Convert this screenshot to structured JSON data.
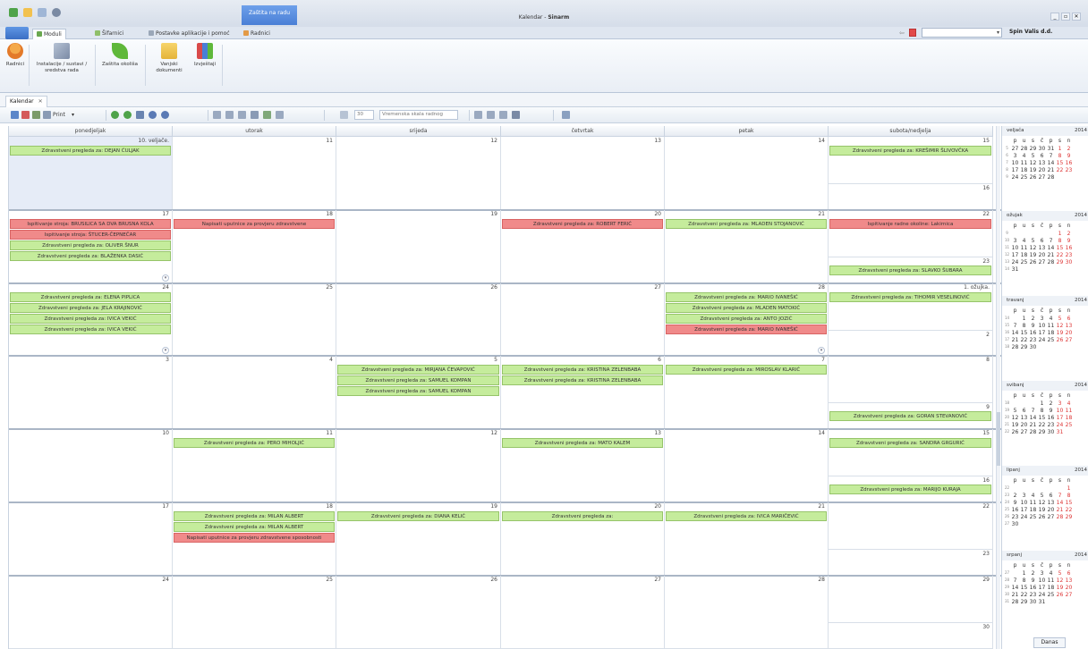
{
  "titlebar": {
    "context_tab": "Zaštita na radu",
    "app_name": "Kalendar",
    "separator": " - ",
    "app_brand": "Sinarm",
    "controls": [
      "_",
      "▫",
      "✕"
    ]
  },
  "ribbon_tabs": [
    "Moduli",
    "Šifarnici",
    "Postavke aplikacije i pomoć",
    "Radnici"
  ],
  "company": "Spin Valis d.d.",
  "search": {
    "value": "",
    "dropdown": "▾"
  },
  "ribbon_buttons": [
    {
      "label": "Radnici"
    },
    {
      "label": "Instalacije / sustavi / sredstva rada"
    },
    {
      "label": "Zaštita okoliša"
    },
    {
      "label": "Vanjski dokumenti"
    },
    {
      "label": "Izvještaji"
    }
  ],
  "doc_tab": {
    "label": "Kalendar",
    "close": "✕"
  },
  "toolbar": {
    "print_label": "Print",
    "hours_value": "30",
    "workday_label": "Vremenska skala radnog",
    "dd": "▾"
  },
  "day_headers": [
    "ponedjeljak",
    "utorak",
    "srijeda",
    "četvrtak",
    "petak",
    "subota/nedjelja"
  ],
  "weeks": [
    {
      "days": [
        {
          "num": "10. veljače.",
          "events": [
            {
              "text": "Zdravstveni pregleda za: DEJAN ĆULJAK",
              "type": "green"
            }
          ]
        },
        {
          "num": "11",
          "events": []
        },
        {
          "num": "12",
          "events": []
        },
        {
          "num": "13",
          "events": []
        },
        {
          "num": "14",
          "events": []
        },
        {
          "num": "15",
          "events": [
            {
              "text": "Zdravstveni pregleda za: KREŠIMIR ŠLIVOVČKA",
              "type": "green"
            }
          ]
        }
      ],
      "sunday": {
        "num": "16",
        "events": []
      }
    },
    {
      "days": [
        {
          "num": "17",
          "events": [
            {
              "text": "Ispitivanje stroja: BRUSILICA SA DVA BRUSNA KOLA",
              "type": "red"
            },
            {
              "text": "Ispitivanje stroja: ŠTUCER-ČEPNEČAR",
              "type": "red"
            },
            {
              "text": "Zdravstveni pregleda za: OLIVER ŠNUR",
              "type": "green"
            },
            {
              "text": "Zdravstveni pregleda za: BLAŽENKA DASIĆ",
              "type": "green"
            }
          ]
        },
        {
          "num": "18",
          "events": [
            {
              "text": "Napisati uputnice za provjeru zdravstvene",
              "type": "red"
            }
          ]
        },
        {
          "num": "19",
          "events": []
        },
        {
          "num": "20",
          "events": [
            {
              "text": "Zdravstveni pregleda za: ROBERT FERIĆ",
              "type": "red"
            }
          ]
        },
        {
          "num": "21",
          "events": [
            {
              "text": "Zdravstveni pregleda za: MLADEN STOJANOVIĆ",
              "type": "green"
            }
          ]
        },
        {
          "num": "22",
          "events": [
            {
              "text": "Ispitivanje radne okoline: Lakirnica",
              "type": "red"
            }
          ]
        }
      ],
      "sunday": {
        "num": "23",
        "events": [
          {
            "text": "Zdravstveni pregleda za: SLAVKO ŠUBARA",
            "type": "green"
          }
        ]
      }
    },
    {
      "days": [
        {
          "num": "24",
          "events": [
            {
              "text": "Zdravstveni pregleda za: ELENA PIPLICA",
              "type": "green"
            },
            {
              "text": "Zdravstveni pregleda za: JELA KRAJINOVIĆ",
              "type": "green"
            },
            {
              "text": "Zdravstveni pregleda za: IVICA VEKIĆ",
              "type": "green"
            },
            {
              "text": "Zdravstveni pregleda za: IVICA VEKIĆ",
              "type": "green"
            }
          ]
        },
        {
          "num": "25",
          "events": []
        },
        {
          "num": "26",
          "events": []
        },
        {
          "num": "27",
          "events": []
        },
        {
          "num": "28",
          "events": [
            {
              "text": "Zdravstveni pregleda za: MARIO IVANEŠIĆ",
              "type": "green"
            },
            {
              "text": "Zdravstveni pregleda za: MLADEN MATOKIĆ",
              "type": "green"
            },
            {
              "text": "Zdravstveni pregleda za: ANTO JOZIĆ",
              "type": "green"
            },
            {
              "text": "Zdravstveni pregleda za: MARIO IVANEŠIĆ",
              "type": "red"
            }
          ]
        },
        {
          "num": "1. ožujka.",
          "events": [
            {
              "text": "Zdravstveni pregleda za: TIHOMIR VESELINOVIĆ",
              "type": "green"
            }
          ]
        }
      ],
      "sunday": {
        "num": "2",
        "events": []
      }
    },
    {
      "days": [
        {
          "num": "3",
          "events": []
        },
        {
          "num": "4",
          "events": []
        },
        {
          "num": "5",
          "events": [
            {
              "text": "Zdravstveni pregleda za: MIRJANA ČEVAPOVIĆ",
              "type": "green"
            },
            {
              "text": "Zdravstveni pregleda za: SAMUEL KOMPAN",
              "type": "green"
            },
            {
              "text": "Zdravstveni pregleda za: SAMUEL KOMPAN",
              "type": "green"
            }
          ]
        },
        {
          "num": "6",
          "events": [
            {
              "text": "Zdravstveni pregleda za: KRISTINA ZELENBABA",
              "type": "green"
            },
            {
              "text": "Zdravstveni pregleda za: KRISTINA ZELENBABA",
              "type": "green"
            }
          ]
        },
        {
          "num": "7",
          "events": [
            {
              "text": "Zdravstveni pregleda za: MIROSLAV KLARIĆ",
              "type": "green"
            }
          ]
        },
        {
          "num": "8",
          "events": []
        }
      ],
      "sunday": {
        "num": "9",
        "events": [
          {
            "text": "Zdravstveni pregleda za: GORAN STEVANOVIĆ",
            "type": "green"
          }
        ]
      }
    },
    {
      "days": [
        {
          "num": "10",
          "events": []
        },
        {
          "num": "11",
          "events": [
            {
              "text": "Zdravstveni pregleda za: PERO MIHOLJIĆ",
              "type": "green"
            }
          ]
        },
        {
          "num": "12",
          "events": []
        },
        {
          "num": "13",
          "events": [
            {
              "text": "Zdravstveni pregleda za: MATO KALEM",
              "type": "green"
            }
          ]
        },
        {
          "num": "14",
          "events": []
        },
        {
          "num": "15",
          "events": [
            {
              "text": "Zdravstveni pregleda za: SANDRA GRGURIĆ",
              "type": "green"
            }
          ]
        }
      ],
      "sunday": {
        "num": "16",
        "events": [
          {
            "text": "Zdravstveni pregleda za: MARIJO KURAJA",
            "type": "green"
          }
        ]
      }
    },
    {
      "days": [
        {
          "num": "17",
          "events": []
        },
        {
          "num": "18",
          "events": [
            {
              "text": "Zdravstveni pregleda za: MILAN ALBERT",
              "type": "green"
            },
            {
              "text": "Zdravstveni pregleda za: MILAN ALBERT",
              "type": "green"
            },
            {
              "text": "Napisati uputnice za provjeru zdravstvene sposobnosti",
              "type": "red"
            }
          ]
        },
        {
          "num": "19",
          "events": [
            {
              "text": "Zdravstveni pregleda za: DIANA KELIĆ",
              "type": "green"
            }
          ]
        },
        {
          "num": "20",
          "events": [
            {
              "text": "Zdravstveni pregleda za:",
              "type": "green"
            }
          ]
        },
        {
          "num": "21",
          "events": [
            {
              "text": "Zdravstveni pregleda za: IVICA MARIČEVIĆ",
              "type": "green"
            }
          ]
        },
        {
          "num": "22",
          "events": []
        }
      ],
      "sunday": {
        "num": "23",
        "events": []
      }
    },
    {
      "days": [
        {
          "num": "24",
          "events": []
        },
        {
          "num": "25",
          "events": []
        },
        {
          "num": "26",
          "events": []
        },
        {
          "num": "27",
          "events": []
        },
        {
          "num": "28",
          "events": []
        },
        {
          "num": "29",
          "events": []
        }
      ],
      "sunday": {
        "num": "30",
        "events": []
      }
    }
  ],
  "date_navigator": {
    "dow": [
      "p",
      "u",
      "s",
      "č",
      "p",
      "s",
      "n"
    ],
    "months": [
      {
        "name": "veljača",
        "year": "2014",
        "rows": [
          {
            "wk": "5",
            "days": [
              "27",
              "28",
              "29",
              "30",
              "31",
              "1",
              "2"
            ]
          },
          {
            "wk": "6",
            "days": [
              "3",
              "4",
              "5",
              "6",
              "7",
              "8",
              "9"
            ]
          },
          {
            "wk": "7",
            "days": [
              "10",
              "11",
              "12",
              "13",
              "14",
              "15",
              "16"
            ]
          },
          {
            "wk": "8",
            "days": [
              "17",
              "18",
              "19",
              "20",
              "21",
              "22",
              "23"
            ]
          },
          {
            "wk": "9",
            "days": [
              "24",
              "25",
              "26",
              "27",
              "28",
              "",
              ""
            ]
          }
        ]
      },
      {
        "name": "ožujak",
        "year": "2014",
        "rows": [
          {
            "wk": "9",
            "days": [
              "",
              "",
              "",
              "",
              "",
              "1",
              "2"
            ]
          },
          {
            "wk": "10",
            "days": [
              "3",
              "4",
              "5",
              "6",
              "7",
              "8",
              "9"
            ]
          },
          {
            "wk": "11",
            "days": [
              "10",
              "11",
              "12",
              "13",
              "14",
              "15",
              "16"
            ]
          },
          {
            "wk": "12",
            "days": [
              "17",
              "18",
              "19",
              "20",
              "21",
              "22",
              "23"
            ]
          },
          {
            "wk": "13",
            "days": [
              "24",
              "25",
              "26",
              "27",
              "28",
              "29",
              "30"
            ]
          },
          {
            "wk": "14",
            "days": [
              "31",
              "",
              "",
              "",
              "",
              "",
              ""
            ]
          }
        ]
      },
      {
        "name": "travanj",
        "year": "2014",
        "rows": [
          {
            "wk": "14",
            "days": [
              "",
              "1",
              "2",
              "3",
              "4",
              "5",
              "6"
            ]
          },
          {
            "wk": "15",
            "days": [
              "7",
              "8",
              "9",
              "10",
              "11",
              "12",
              "13"
            ]
          },
          {
            "wk": "16",
            "days": [
              "14",
              "15",
              "16",
              "17",
              "18",
              "19",
              "20"
            ]
          },
          {
            "wk": "17",
            "days": [
              "21",
              "22",
              "23",
              "24",
              "25",
              "26",
              "27"
            ]
          },
          {
            "wk": "18",
            "days": [
              "28",
              "29",
              "30",
              "",
              "",
              "",
              ""
            ]
          }
        ]
      },
      {
        "name": "svibanj",
        "year": "2014",
        "rows": [
          {
            "wk": "18",
            "days": [
              "",
              "",
              "",
              "1",
              "2",
              "3",
              "4"
            ]
          },
          {
            "wk": "19",
            "days": [
              "5",
              "6",
              "7",
              "8",
              "9",
              "10",
              "11"
            ]
          },
          {
            "wk": "20",
            "days": [
              "12",
              "13",
              "14",
              "15",
              "16",
              "17",
              "18"
            ]
          },
          {
            "wk": "21",
            "days": [
              "19",
              "20",
              "21",
              "22",
              "23",
              "24",
              "25"
            ]
          },
          {
            "wk": "22",
            "days": [
              "26",
              "27",
              "28",
              "29",
              "30",
              "31",
              ""
            ]
          }
        ]
      },
      {
        "name": "lipanj",
        "year": "2014",
        "rows": [
          {
            "wk": "22",
            "days": [
              "",
              "",
              "",
              "",
              "",
              "",
              "1"
            ]
          },
          {
            "wk": "23",
            "days": [
              "2",
              "3",
              "4",
              "5",
              "6",
              "7",
              "8"
            ]
          },
          {
            "wk": "24",
            "days": [
              "9",
              "10",
              "11",
              "12",
              "13",
              "14",
              "15"
            ]
          },
          {
            "wk": "25",
            "days": [
              "16",
              "17",
              "18",
              "19",
              "20",
              "21",
              "22"
            ]
          },
          {
            "wk": "26",
            "days": [
              "23",
              "24",
              "25",
              "26",
              "27",
              "28",
              "29"
            ]
          },
          {
            "wk": "27",
            "days": [
              "30",
              "",
              "",
              "",
              "",
              "",
              ""
            ]
          }
        ]
      },
      {
        "name": "srpanj",
        "year": "2014",
        "rows": [
          {
            "wk": "27",
            "days": [
              "",
              "1",
              "2",
              "3",
              "4",
              "5",
              "6"
            ]
          },
          {
            "wk": "28",
            "days": [
              "7",
              "8",
              "9",
              "10",
              "11",
              "12",
              "13"
            ]
          },
          {
            "wk": "29",
            "days": [
              "14",
              "15",
              "16",
              "17",
              "18",
              "19",
              "20"
            ]
          },
          {
            "wk": "30",
            "days": [
              "21",
              "22",
              "23",
              "24",
              "25",
              "26",
              "27"
            ]
          },
          {
            "wk": "31",
            "days": [
              "28",
              "29",
              "30",
              "31",
              "",
              "",
              ""
            ]
          }
        ]
      }
    ],
    "today_label": "Danas"
  }
}
